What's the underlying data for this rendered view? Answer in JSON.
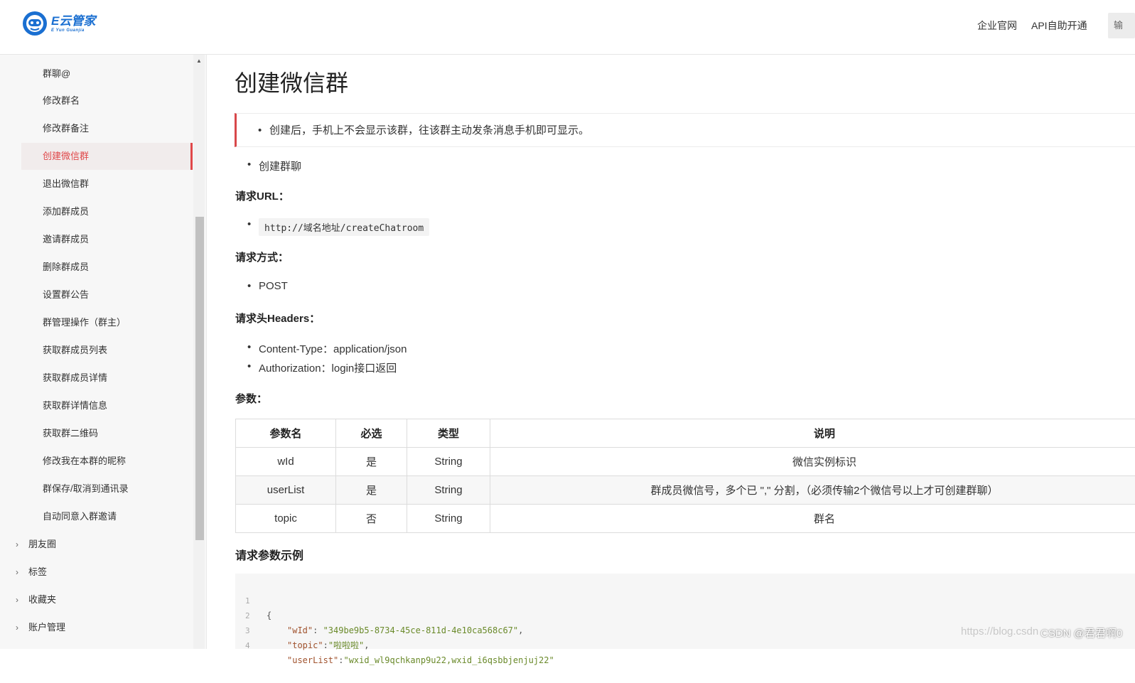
{
  "header": {
    "logo_text": "E云管家",
    "logo_sub": "E Yun Guanjia",
    "nav": [
      "企业官网",
      "API自助开通"
    ],
    "right_button": "输"
  },
  "sidebar": {
    "items": [
      {
        "label": "群聊@",
        "active": false
      },
      {
        "label": "修改群名",
        "active": false
      },
      {
        "label": "修改群备注",
        "active": false
      },
      {
        "label": "创建微信群",
        "active": true
      },
      {
        "label": "退出微信群",
        "active": false
      },
      {
        "label": "添加群成员",
        "active": false
      },
      {
        "label": "邀请群成员",
        "active": false
      },
      {
        "label": "删除群成员",
        "active": false
      },
      {
        "label": "设置群公告",
        "active": false
      },
      {
        "label": "群管理操作（群主）",
        "active": false
      },
      {
        "label": "获取群成员列表",
        "active": false
      },
      {
        "label": "获取群成员详情",
        "active": false
      },
      {
        "label": "获取群详情信息",
        "active": false
      },
      {
        "label": "获取群二维码",
        "active": false
      },
      {
        "label": "修改我在本群的昵称",
        "active": false
      },
      {
        "label": "群保存/取消到通讯录",
        "active": false
      },
      {
        "label": "自动同意入群邀请",
        "active": false
      }
    ],
    "groups": [
      "朋友圈",
      "标签",
      "收藏夹",
      "账户管理"
    ]
  },
  "main": {
    "title": "创建微信群",
    "note": "创建后，手机上不会显示该群，往该群主动发条消息手机即可显示。",
    "intro_bullet": "创建群聊",
    "url_heading": "请求URL：",
    "url": "http://域名地址/createChatroom",
    "method_heading": "请求方式：",
    "method": "POST",
    "headers_heading": "请求头Headers：",
    "headers": [
      "Content-Type：application/json",
      "Authorization：login接口返回"
    ],
    "params_heading": "参数：",
    "table": {
      "columns": [
        "参数名",
        "必选",
        "类型",
        "说明"
      ],
      "rows": [
        [
          "wId",
          "是",
          "String",
          "微信实例标识"
        ],
        [
          "userList",
          "是",
          "String",
          "群成员微信号，多个已 \",\" 分割，（必须传输2个微信号以上才可创建群聊）"
        ],
        [
          "topic",
          "否",
          "String",
          "群名"
        ]
      ]
    },
    "example_heading": "请求参数示例",
    "code": {
      "line_numbers": [
        "1",
        "2",
        "3",
        "4"
      ],
      "open_brace": "{",
      "wid_key": "\"wId\"",
      "wid_value": "\"349be9b5-8734-45ce-811d-4e10ca568c67\"",
      "topic_key": "\"topic\"",
      "topic_value": "\"啦啦啦\"",
      "userlist_key": "\"userList\"",
      "userlist_value": "\"wxid_wl9qchkanp9u22,wxid_i6qsbbjenjuj22\""
    }
  },
  "watermark": "https://blog.csdn",
  "csdn_label": "CSDN @君君啊0"
}
